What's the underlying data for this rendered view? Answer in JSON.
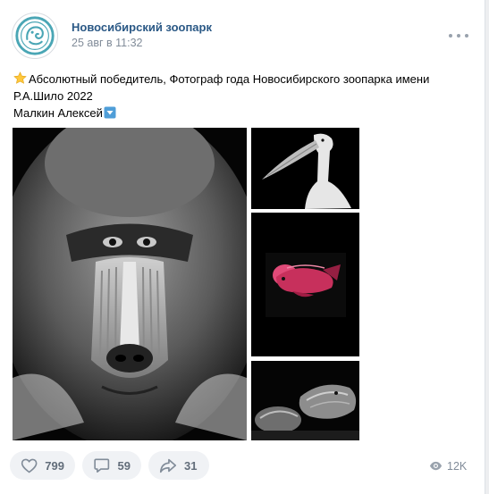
{
  "post": {
    "group_name": "Новосибирский зоопарк",
    "date": "25 авг в 11:32",
    "text_line1": "Абсолютный победитель, Фотограф года Новосибирского зоопарка имени",
    "text_line2": "Р.А.Шило 2022",
    "text_line3": "Малкин Алексей"
  },
  "footer": {
    "likes": "799",
    "comments": "59",
    "shares": "31",
    "views": "12K"
  },
  "icons": {
    "star": "star-icon",
    "down_arrow": "down-arrow-box-icon",
    "like": "heart-icon",
    "comment": "comment-icon",
    "share": "share-arrow-icon",
    "views": "eye-icon",
    "more": "more-dots-icon"
  },
  "colors": {
    "link": "#2a5885",
    "meta": "#818c99",
    "action_bg": "#f0f2f5",
    "action_text": "#626d7a",
    "avatar_logo": "#4aa6b5"
  }
}
